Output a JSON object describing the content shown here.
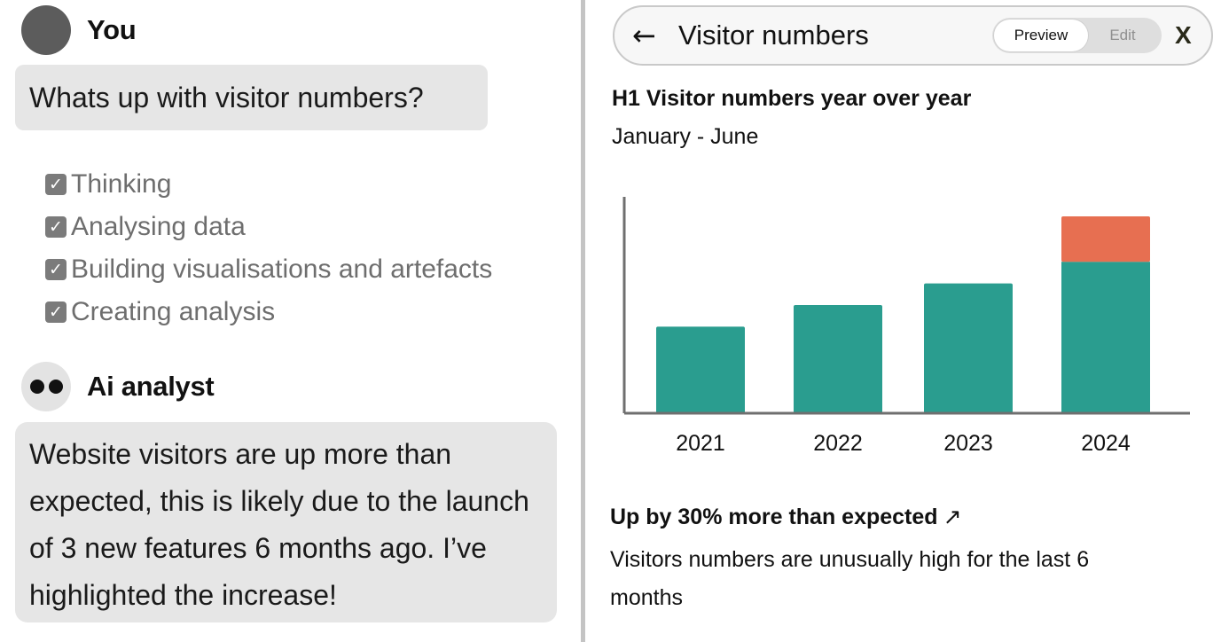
{
  "chat": {
    "user": {
      "name": "You",
      "message": "Whats up with visitor numbers?"
    },
    "steps": [
      {
        "label": "Thinking",
        "done": true
      },
      {
        "label": "Analysing data",
        "done": true
      },
      {
        "label": "Building visualisations and artefacts",
        "done": true
      },
      {
        "label": "Creating analysis",
        "done": true
      }
    ],
    "ai": {
      "name": "Ai analyst",
      "message": "Website visitors are up more than expected, this is likely due to the launch of 3 new features 6 months ago. I’ve highlighted the increase!"
    }
  },
  "artefact": {
    "title": "Visitor numbers",
    "back_icon": "arrow-left-icon",
    "toggle": {
      "preview_label": "Preview",
      "edit_label": "Edit",
      "selected": "Preview"
    },
    "close_label": "X",
    "chart_title": "H1 Visitor numbers year over year",
    "chart_subtitle": "January - June",
    "insight": {
      "title": "Up by 30% more than expected",
      "icon": "arrow-up-right-icon",
      "text": "Visitors numbers are unusually high for the last 6 months"
    }
  },
  "colors": {
    "bar": "#2a9d8f",
    "highlight": "#e76f51",
    "axis": "#6f6f6f",
    "bubble": "#e6e6e6"
  },
  "chart_data": {
    "type": "bar",
    "categories": [
      "2021",
      "2022",
      "2023",
      "2024"
    ],
    "series": [
      {
        "values": [
          40,
          50,
          60,
          70
        ]
      },
      {
        "values": [
          0,
          0,
          0,
          21
        ]
      }
    ],
    "stacked": true,
    "ylim": [
      0,
      100
    ],
    "grid": false,
    "y_ticks_shown": false
  }
}
